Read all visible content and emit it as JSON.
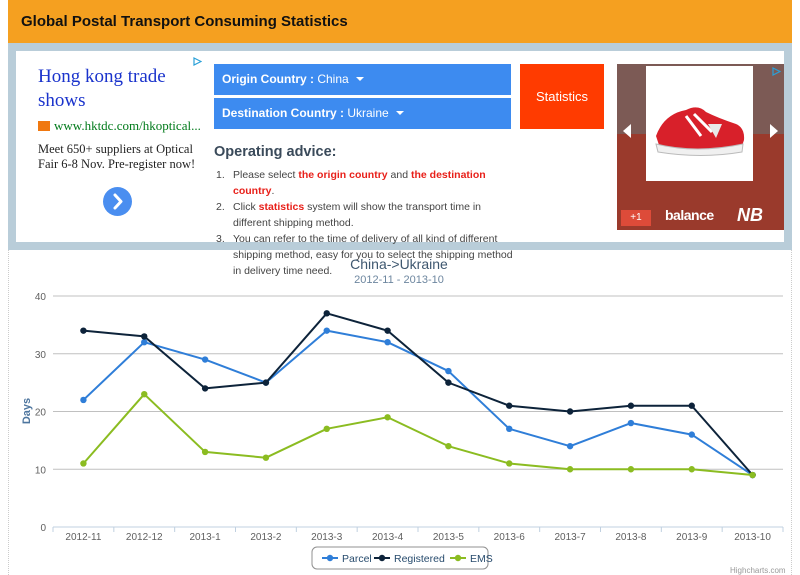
{
  "header": {
    "title": "Global Postal Transport Consuming Statistics"
  },
  "ad_left": {
    "title": "Hong kong trade shows",
    "url": "www.hktdc.com/hkoptical...",
    "text": "Meet 650+ suppliers at Optical Fair 6-8 Nov. Pre-register now!"
  },
  "controls": {
    "origin_label": "Origin Country :",
    "origin_value": "China",
    "destination_label": "Destination Country :",
    "destination_value": "Ukraine",
    "statistics_label": "Statistics"
  },
  "advice": {
    "title": "Operating advice:",
    "items": [
      {
        "num": "1.",
        "pre": "Please select ",
        "red1": "the origin country",
        "mid": " and ",
        "red2": "the destination country",
        "post": "."
      },
      {
        "num": "2.",
        "pre": "Click ",
        "red1": "statistics",
        "post": " system will show the transport time in different shipping method."
      },
      {
        "num": "3.",
        "text": "You can refer to the time of delivery of all kind of different shipping method, easy for you to select the shipping method in delivery time need."
      }
    ]
  },
  "ad_right": {
    "gplus": "+1",
    "brand_text": "balance",
    "brand_logo": "NB"
  },
  "credit": "Highcharts.com",
  "chart_data": {
    "type": "line",
    "title": "China->Ukraine",
    "subtitle": "2012-11 - 2013-10",
    "ylabel": "Days",
    "xlabel": "",
    "ylim": [
      0,
      40
    ],
    "yticks": [
      0,
      10,
      20,
      30,
      40
    ],
    "grid": true,
    "legend_position": "bottom-center",
    "categories": [
      "2012-11",
      "2012-12",
      "2013-1",
      "2013-2",
      "2013-3",
      "2013-4",
      "2013-5",
      "2013-6",
      "2013-7",
      "2013-8",
      "2013-9",
      "2013-10"
    ],
    "series": [
      {
        "name": "Parcel",
        "color": "#2f7ed8",
        "values": [
          22,
          32,
          29,
          25,
          34,
          32,
          27,
          17,
          14,
          18,
          16,
          9
        ]
      },
      {
        "name": "Registered",
        "color": "#0d233a",
        "values": [
          34,
          33,
          24,
          25,
          37,
          34,
          25,
          21,
          20,
          21,
          21,
          9
        ]
      },
      {
        "name": "EMS",
        "color": "#8bbc21",
        "values": [
          11,
          23,
          13,
          12,
          17,
          19,
          14,
          11,
          10,
          10,
          10,
          9
        ]
      }
    ]
  }
}
